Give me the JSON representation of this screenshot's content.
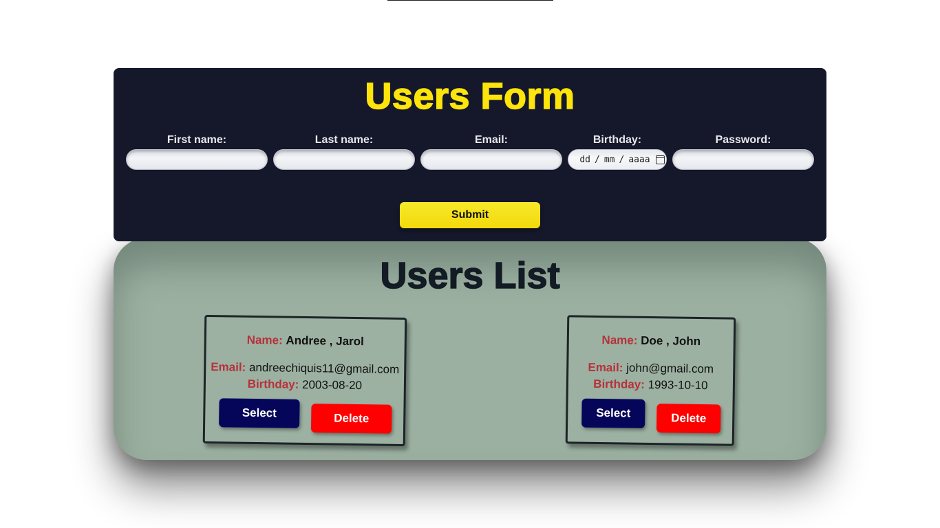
{
  "form": {
    "title": "Users Form",
    "fields": {
      "first_name": {
        "label": "First name:",
        "value": ""
      },
      "last_name": {
        "label": "Last name:",
        "value": ""
      },
      "email": {
        "label": "Email:",
        "value": ""
      },
      "birthday": {
        "label": "Birthday:",
        "dd": "dd",
        "mm": "mm",
        "yyyy": "aaaa",
        "sep": "/"
      },
      "password": {
        "label": "Password:",
        "value": ""
      }
    },
    "submit_label": "Submit"
  },
  "list": {
    "title": "Users List",
    "labels": {
      "name": "Name:",
      "email": "Email:",
      "birthday": "Birthday:"
    },
    "select_label": "Select",
    "delete_label": "Delete",
    "users": [
      {
        "last": "Andree",
        "first": "Jarol",
        "email": "andreechiquis11@gmail.com",
        "birthday": "2003-08-20"
      },
      {
        "last": "Doe",
        "first": "John",
        "email": "john@gmail.com",
        "birthday": "1993-10-10"
      }
    ]
  },
  "colors": {
    "form_bg": "#15182b",
    "accent_yellow": "#fde40b",
    "list_bg": "#9bb0a1",
    "label_red": "#b7313a",
    "select_blue": "#05055a",
    "delete_red": "#ff0000"
  }
}
